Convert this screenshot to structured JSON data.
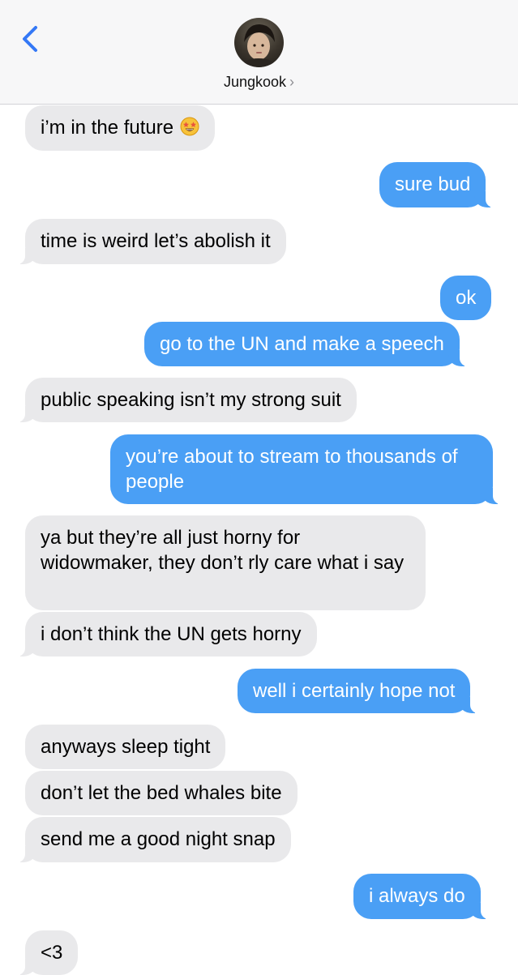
{
  "header": {
    "contact_name": "Jungkook",
    "chevron": "›",
    "back_icon": "chevron-left-icon",
    "accent": "#3478f6"
  },
  "colors": {
    "incoming": "#e9e9eb",
    "outgoing": "#4a9ff5"
  },
  "messages": [
    {
      "from": "them",
      "text": "i’m in the future",
      "emoji": "star-struck-emoji"
    },
    {
      "from": "me",
      "text": "sure bud"
    },
    {
      "from": "them",
      "text": "time is weird let’s abolish it"
    },
    {
      "from": "me",
      "text": "ok"
    },
    {
      "from": "me",
      "text": "go to the UN and make a speech"
    },
    {
      "from": "them",
      "text": "public speaking isn’t my strong suit"
    },
    {
      "from": "me",
      "text": "you’re about to stream to thousands of people"
    },
    {
      "from": "them",
      "text": "ya but they’re all just horny for widowmaker, they don’t rly care what i say"
    },
    {
      "from": "them",
      "text": "i don’t think the UN gets horny"
    },
    {
      "from": "me",
      "text": "well i certainly hope not"
    },
    {
      "from": "them",
      "text": "anyways sleep tight"
    },
    {
      "from": "them",
      "text": "don’t let the bed whales bite"
    },
    {
      "from": "them",
      "text": "send me a good night snap"
    },
    {
      "from": "me",
      "text": "i always do"
    },
    {
      "from": "them",
      "text": "<3"
    }
  ]
}
